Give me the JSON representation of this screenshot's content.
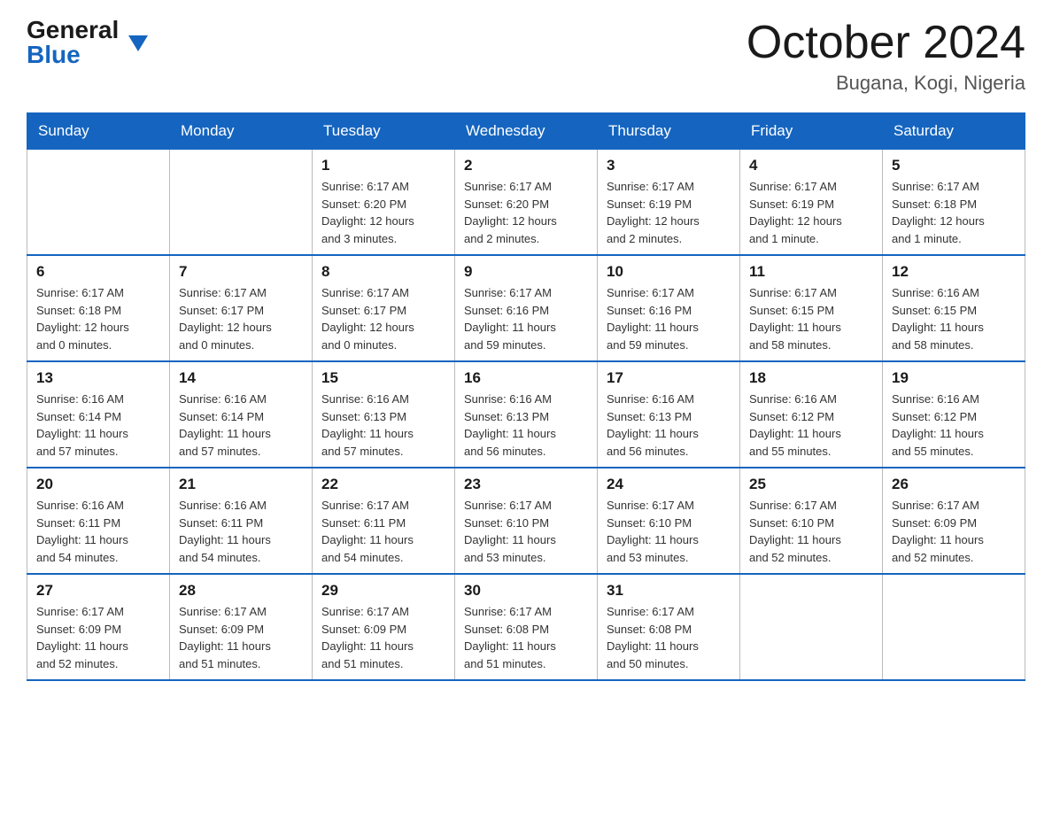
{
  "header": {
    "logo_general": "General",
    "logo_blue": "Blue",
    "month_title": "October 2024",
    "location": "Bugana, Kogi, Nigeria"
  },
  "weekdays": [
    "Sunday",
    "Monday",
    "Tuesday",
    "Wednesday",
    "Thursday",
    "Friday",
    "Saturday"
  ],
  "weeks": [
    [
      {
        "day": "",
        "info": ""
      },
      {
        "day": "",
        "info": ""
      },
      {
        "day": "1",
        "info": "Sunrise: 6:17 AM\nSunset: 6:20 PM\nDaylight: 12 hours\nand 3 minutes."
      },
      {
        "day": "2",
        "info": "Sunrise: 6:17 AM\nSunset: 6:20 PM\nDaylight: 12 hours\nand 2 minutes."
      },
      {
        "day": "3",
        "info": "Sunrise: 6:17 AM\nSunset: 6:19 PM\nDaylight: 12 hours\nand 2 minutes."
      },
      {
        "day": "4",
        "info": "Sunrise: 6:17 AM\nSunset: 6:19 PM\nDaylight: 12 hours\nand 1 minute."
      },
      {
        "day": "5",
        "info": "Sunrise: 6:17 AM\nSunset: 6:18 PM\nDaylight: 12 hours\nand 1 minute."
      }
    ],
    [
      {
        "day": "6",
        "info": "Sunrise: 6:17 AM\nSunset: 6:18 PM\nDaylight: 12 hours\nand 0 minutes."
      },
      {
        "day": "7",
        "info": "Sunrise: 6:17 AM\nSunset: 6:17 PM\nDaylight: 12 hours\nand 0 minutes."
      },
      {
        "day": "8",
        "info": "Sunrise: 6:17 AM\nSunset: 6:17 PM\nDaylight: 12 hours\nand 0 minutes."
      },
      {
        "day": "9",
        "info": "Sunrise: 6:17 AM\nSunset: 6:16 PM\nDaylight: 11 hours\nand 59 minutes."
      },
      {
        "day": "10",
        "info": "Sunrise: 6:17 AM\nSunset: 6:16 PM\nDaylight: 11 hours\nand 59 minutes."
      },
      {
        "day": "11",
        "info": "Sunrise: 6:17 AM\nSunset: 6:15 PM\nDaylight: 11 hours\nand 58 minutes."
      },
      {
        "day": "12",
        "info": "Sunrise: 6:16 AM\nSunset: 6:15 PM\nDaylight: 11 hours\nand 58 minutes."
      }
    ],
    [
      {
        "day": "13",
        "info": "Sunrise: 6:16 AM\nSunset: 6:14 PM\nDaylight: 11 hours\nand 57 minutes."
      },
      {
        "day": "14",
        "info": "Sunrise: 6:16 AM\nSunset: 6:14 PM\nDaylight: 11 hours\nand 57 minutes."
      },
      {
        "day": "15",
        "info": "Sunrise: 6:16 AM\nSunset: 6:13 PM\nDaylight: 11 hours\nand 57 minutes."
      },
      {
        "day": "16",
        "info": "Sunrise: 6:16 AM\nSunset: 6:13 PM\nDaylight: 11 hours\nand 56 minutes."
      },
      {
        "day": "17",
        "info": "Sunrise: 6:16 AM\nSunset: 6:13 PM\nDaylight: 11 hours\nand 56 minutes."
      },
      {
        "day": "18",
        "info": "Sunrise: 6:16 AM\nSunset: 6:12 PM\nDaylight: 11 hours\nand 55 minutes."
      },
      {
        "day": "19",
        "info": "Sunrise: 6:16 AM\nSunset: 6:12 PM\nDaylight: 11 hours\nand 55 minutes."
      }
    ],
    [
      {
        "day": "20",
        "info": "Sunrise: 6:16 AM\nSunset: 6:11 PM\nDaylight: 11 hours\nand 54 minutes."
      },
      {
        "day": "21",
        "info": "Sunrise: 6:16 AM\nSunset: 6:11 PM\nDaylight: 11 hours\nand 54 minutes."
      },
      {
        "day": "22",
        "info": "Sunrise: 6:17 AM\nSunset: 6:11 PM\nDaylight: 11 hours\nand 54 minutes."
      },
      {
        "day": "23",
        "info": "Sunrise: 6:17 AM\nSunset: 6:10 PM\nDaylight: 11 hours\nand 53 minutes."
      },
      {
        "day": "24",
        "info": "Sunrise: 6:17 AM\nSunset: 6:10 PM\nDaylight: 11 hours\nand 53 minutes."
      },
      {
        "day": "25",
        "info": "Sunrise: 6:17 AM\nSunset: 6:10 PM\nDaylight: 11 hours\nand 52 minutes."
      },
      {
        "day": "26",
        "info": "Sunrise: 6:17 AM\nSunset: 6:09 PM\nDaylight: 11 hours\nand 52 minutes."
      }
    ],
    [
      {
        "day": "27",
        "info": "Sunrise: 6:17 AM\nSunset: 6:09 PM\nDaylight: 11 hours\nand 52 minutes."
      },
      {
        "day": "28",
        "info": "Sunrise: 6:17 AM\nSunset: 6:09 PM\nDaylight: 11 hours\nand 51 minutes."
      },
      {
        "day": "29",
        "info": "Sunrise: 6:17 AM\nSunset: 6:09 PM\nDaylight: 11 hours\nand 51 minutes."
      },
      {
        "day": "30",
        "info": "Sunrise: 6:17 AM\nSunset: 6:08 PM\nDaylight: 11 hours\nand 51 minutes."
      },
      {
        "day": "31",
        "info": "Sunrise: 6:17 AM\nSunset: 6:08 PM\nDaylight: 11 hours\nand 50 minutes."
      },
      {
        "day": "",
        "info": ""
      },
      {
        "day": "",
        "info": ""
      }
    ]
  ]
}
